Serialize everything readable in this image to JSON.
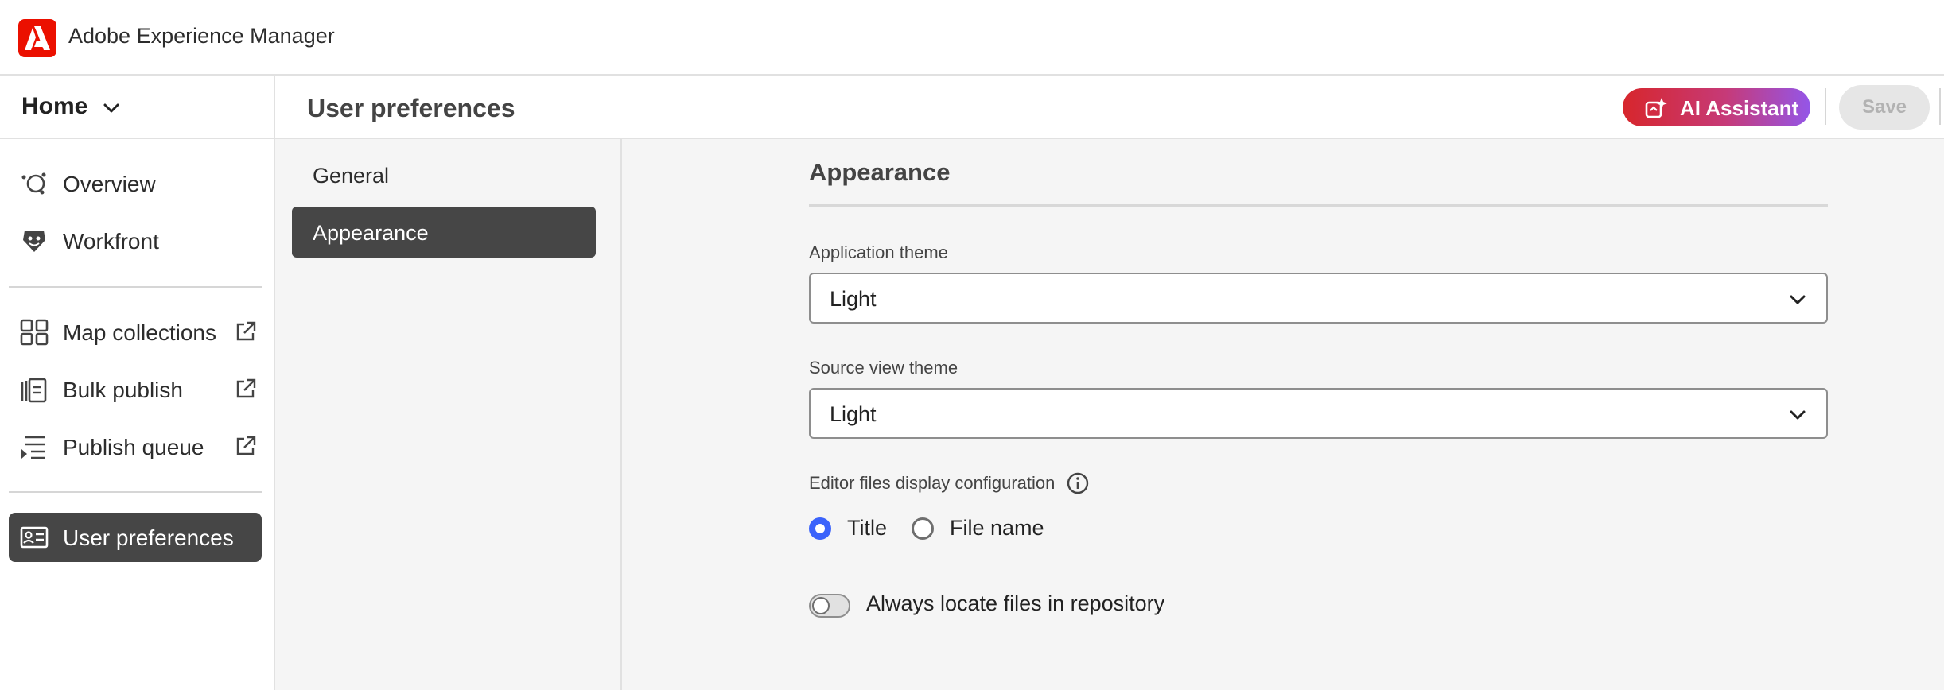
{
  "app": {
    "title": "Adobe Experience Manager"
  },
  "leftnav": {
    "home_label": "Home",
    "items": [
      {
        "label": "Overview",
        "icon": "overview-icon"
      },
      {
        "label": "Workfront",
        "icon": "workfront-icon"
      },
      {
        "label": "Map collections",
        "icon": "map-collections-icon",
        "external": true
      },
      {
        "label": "Bulk publish",
        "icon": "bulk-publish-icon",
        "external": true
      },
      {
        "label": "Publish queue",
        "icon": "publish-queue-icon",
        "external": true
      },
      {
        "label": "User preferences",
        "icon": "user-preferences-icon",
        "active": true
      }
    ]
  },
  "header": {
    "title": "User preferences",
    "ai_assistant_label": "AI Assistant",
    "save_label": "Save"
  },
  "subnav": {
    "items": [
      {
        "label": "General"
      },
      {
        "label": "Appearance",
        "active": true
      }
    ]
  },
  "content": {
    "section_title": "Appearance",
    "application_theme": {
      "label": "Application theme",
      "value": "Light"
    },
    "source_view_theme": {
      "label": "Source view theme",
      "value": "Light"
    },
    "editor_files_display": {
      "label": "Editor files display configuration",
      "options": [
        {
          "label": "Title",
          "checked": true
        },
        {
          "label": "File name",
          "checked": false
        }
      ]
    },
    "always_locate": {
      "label": "Always locate files in repository",
      "on": false
    }
  },
  "colors": {
    "brand_red": "#eb1000",
    "active_nav": "#464646",
    "radio_accent": "#3b63fb"
  }
}
